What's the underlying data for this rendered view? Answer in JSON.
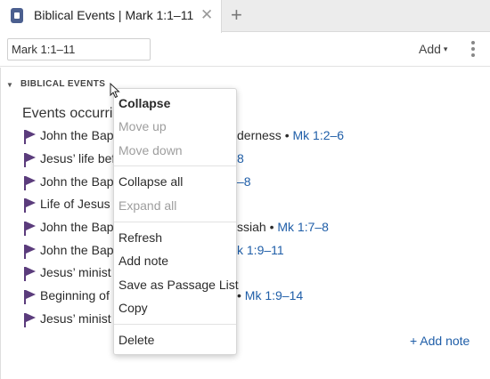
{
  "tab": {
    "title": "Biblical Events | Mark 1:1–11",
    "close": "✕",
    "add": "+"
  },
  "toolbar": {
    "reference": "Mark 1:1–11",
    "add_label": "Add",
    "add_caret": "▾"
  },
  "section": {
    "caret": "▼",
    "title": "BIBLICAL EVENTS"
  },
  "events": {
    "heading": "Events occurrin",
    "items": [
      {
        "text": "John the Bap",
        "tail": "derness • ",
        "ref": "Mk 1:2–6"
      },
      {
        "text": "Jesus’ life bef",
        "tail": "",
        "ref": "8"
      },
      {
        "text": "John the Bap",
        "tail": "",
        "ref": "–8"
      },
      {
        "text": "Life of Jesus •",
        "tail": "",
        "ref": ""
      },
      {
        "text": "John the Bap",
        "tail": "ssiah • ",
        "ref": "Mk 1:7–8"
      },
      {
        "text": "John the Bap",
        "tail": "",
        "ref": "k 1:9–11"
      },
      {
        "text": "Jesus’ minist",
        "tail": "",
        "ref": ""
      },
      {
        "text": "Beginning of",
        "tail": "• ",
        "ref": "Mk 1:9–14"
      },
      {
        "text": "Jesus’ minist",
        "tail": "",
        "ref": ""
      }
    ],
    "add_note_link": "+ Add note"
  },
  "context_menu": {
    "collapse": "Collapse",
    "move_up": "Move up",
    "move_down": "Move down",
    "collapse_all": "Collapse all",
    "expand_all": "Expand all",
    "refresh": "Refresh",
    "add_note": "Add note",
    "save_passage_list": "Save as Passage List",
    "copy": "Copy",
    "delete": "Delete"
  },
  "colors": {
    "link": "#1f5ea8",
    "flag": "#5b3c7c",
    "tab_icon": "#4b5f8f"
  }
}
